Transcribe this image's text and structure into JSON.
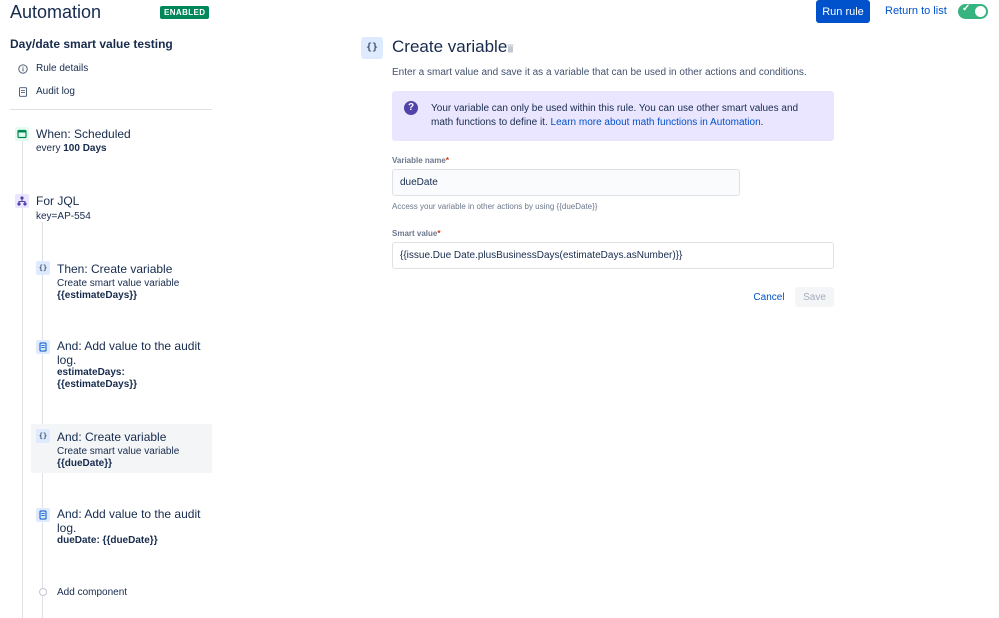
{
  "header": {
    "app_title": "Automation",
    "status_badge": "ENABLED",
    "run_rule": "Run rule",
    "return_to_list": "Return to list",
    "toggle_on": true
  },
  "sidebar": {
    "rule_name": "Day/date smart value testing",
    "links": [
      {
        "label": "Rule details",
        "icon": "info-icon"
      },
      {
        "label": "Audit log",
        "icon": "document-icon"
      }
    ],
    "steps": [
      {
        "title": "When: Scheduled",
        "sub_prefix": "every ",
        "sub_bold": "100 Days",
        "icon": "calendar-icon"
      },
      {
        "title": "For JQL",
        "sub": "key=AP-554",
        "icon": "branch-icon"
      },
      {
        "title": "Then: Create variable",
        "sub": "Create smart value variable",
        "bold": "{{estimateDays}}",
        "icon": "braces-icon"
      },
      {
        "title": "And: Add value to the audit",
        "title2": "log.",
        "bold": "estimateDays:",
        "bold2": "{{estimateDays}}",
        "icon": "audit-icon"
      },
      {
        "title": "And: Create variable",
        "sub": "Create smart value variable",
        "bold": "{{dueDate}}",
        "icon": "braces-icon"
      },
      {
        "title": "And: Add value to the audit",
        "title2": "log.",
        "bold": "dueDate: {{dueDate}}",
        "icon": "audit-icon"
      }
    ],
    "add_component": "Add component"
  },
  "main": {
    "icon_text": "{}",
    "title": "Create variable",
    "description": "Enter a smart value and save it as a variable that can be used in other actions and conditions.",
    "info": {
      "text_line1": "Your variable can only be used within this rule. You can use other smart values and",
      "text_line2_prefix": "math functions to define it. ",
      "link": "Learn more about math functions in Automation",
      "text_suffix": "."
    },
    "variable_name": {
      "label": "Variable name",
      "required": "*",
      "value": "dueDate",
      "help": "Access your variable in other actions by using {{dueDate}}"
    },
    "smart_value": {
      "label": "Smart value",
      "required": "*",
      "value": "{{issue.Due Date.plusBusinessDays(estimateDays.asNumber)}}"
    },
    "cancel": "Cancel",
    "save": "Save"
  },
  "colors": {
    "primary": "#0052cc",
    "enabled": "#00875a",
    "toggle": "#36b37e",
    "info_bg": "#eae6ff"
  }
}
